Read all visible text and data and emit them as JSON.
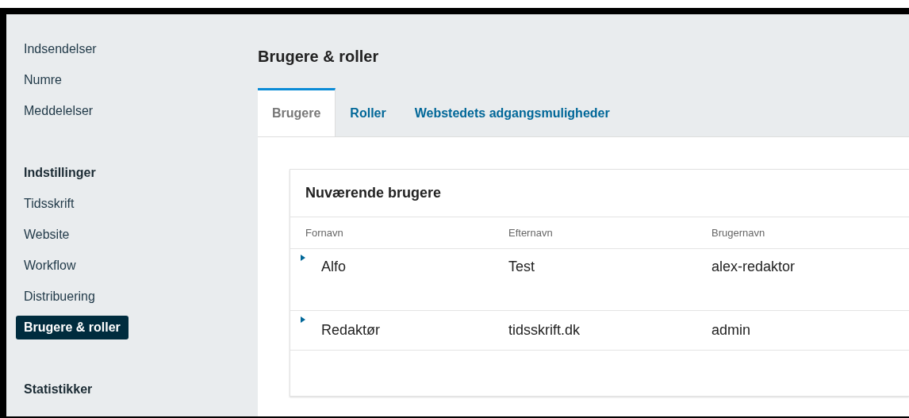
{
  "sidebar": {
    "items": [
      {
        "kind": "link",
        "label": "Indsendelser",
        "selected": false
      },
      {
        "kind": "link",
        "label": "Numre",
        "selected": false
      },
      {
        "kind": "link",
        "label": "Meddelelser",
        "selected": false
      },
      {
        "kind": "heading",
        "label": "Indstillinger"
      },
      {
        "kind": "link",
        "label": "Tidsskrift",
        "selected": false
      },
      {
        "kind": "link",
        "label": "Website",
        "selected": false
      },
      {
        "kind": "link",
        "label": "Workflow",
        "selected": false
      },
      {
        "kind": "link",
        "label": "Distribuering",
        "selected": false
      },
      {
        "kind": "link",
        "label": "Brugere & roller",
        "selected": true
      },
      {
        "kind": "heading",
        "label": "Statistikker"
      }
    ]
  },
  "page_title": "Brugere & roller",
  "tabs": [
    {
      "label": "Brugere",
      "selected": true
    },
    {
      "label": "Roller",
      "selected": false
    },
    {
      "label": "Webstedets adgangsmuligheder",
      "selected": false
    }
  ],
  "panel": {
    "title": "Nuværende brugere",
    "table": {
      "columns": [
        "Fornavn",
        "Efternavn",
        "Brugernavn"
      ],
      "rows": [
        {
          "cells": [
            "Alfo",
            "Test",
            "alex-redaktor"
          ]
        },
        {
          "cells": [
            "Redaktør",
            "tidsskrift.dk",
            "admin"
          ]
        }
      ]
    }
  }
}
